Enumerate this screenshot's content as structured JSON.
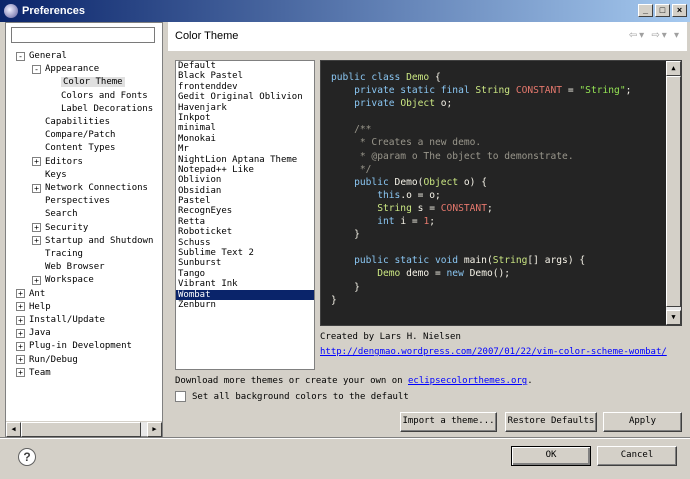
{
  "window": {
    "title": "Preferences"
  },
  "filter": {
    "placeholder": "",
    "value": ""
  },
  "tree": [
    {
      "label": "General",
      "depth": 0,
      "exp": "-"
    },
    {
      "label": "Appearance",
      "depth": 1,
      "exp": "-"
    },
    {
      "label": "Color Theme",
      "depth": 2,
      "exp": "",
      "selected": true
    },
    {
      "label": "Colors and Fonts",
      "depth": 2,
      "exp": ""
    },
    {
      "label": "Label Decorations",
      "depth": 2,
      "exp": ""
    },
    {
      "label": "Capabilities",
      "depth": 1,
      "exp": ""
    },
    {
      "label": "Compare/Patch",
      "depth": 1,
      "exp": ""
    },
    {
      "label": "Content Types",
      "depth": 1,
      "exp": ""
    },
    {
      "label": "Editors",
      "depth": 1,
      "exp": "+"
    },
    {
      "label": "Keys",
      "depth": 1,
      "exp": ""
    },
    {
      "label": "Network Connections",
      "depth": 1,
      "exp": "+"
    },
    {
      "label": "Perspectives",
      "depth": 1,
      "exp": ""
    },
    {
      "label": "Search",
      "depth": 1,
      "exp": ""
    },
    {
      "label": "Security",
      "depth": 1,
      "exp": "+"
    },
    {
      "label": "Startup and Shutdown",
      "depth": 1,
      "exp": "+"
    },
    {
      "label": "Tracing",
      "depth": 1,
      "exp": ""
    },
    {
      "label": "Web Browser",
      "depth": 1,
      "exp": ""
    },
    {
      "label": "Workspace",
      "depth": 1,
      "exp": "+"
    },
    {
      "label": "Ant",
      "depth": 0,
      "exp": "+"
    },
    {
      "label": "Help",
      "depth": 0,
      "exp": "+"
    },
    {
      "label": "Install/Update",
      "depth": 0,
      "exp": "+"
    },
    {
      "label": "Java",
      "depth": 0,
      "exp": "+"
    },
    {
      "label": "Plug-in Development",
      "depth": 0,
      "exp": "+"
    },
    {
      "label": "Run/Debug",
      "depth": 0,
      "exp": "+"
    },
    {
      "label": "Team",
      "depth": 0,
      "exp": "+"
    }
  ],
  "page": {
    "title": "Color Theme"
  },
  "themes": [
    "Default",
    "Black Pastel",
    "frontenddev",
    "Gedit Original Oblivion",
    "Havenjark",
    "Inkpot",
    "minimal",
    "Monokai",
    "Mr",
    "NightLion Aptana Theme",
    "Notepad++ Like",
    "Oblivion",
    "Obsidian",
    "Pastel",
    "RecognEyes",
    "Retta",
    "Roboticket",
    "Schuss",
    "Sublime Text 2",
    "Sunburst",
    "Tango",
    "Vibrant Ink",
    "Wombat",
    "Zenburn"
  ],
  "selected_theme": "Wombat",
  "code_lines": [
    [
      [
        "public class ",
        "kw"
      ],
      [
        "Demo",
        "type"
      ],
      [
        " {",
        "plain"
      ]
    ],
    [
      [
        "    private static final ",
        "kw"
      ],
      [
        "String",
        "type"
      ],
      [
        " ",
        "plain"
      ],
      [
        "CONSTANT",
        "const"
      ],
      [
        " = ",
        "plain"
      ],
      [
        "\"String\"",
        "str"
      ],
      [
        ";",
        "plain"
      ]
    ],
    [
      [
        "    private ",
        "kw"
      ],
      [
        "Object",
        "type"
      ],
      [
        " o;",
        "plain"
      ]
    ],
    [
      [
        "",
        "plain"
      ]
    ],
    [
      [
        "    /**",
        "comment"
      ]
    ],
    [
      [
        "     * Creates a new demo.",
        "comment"
      ]
    ],
    [
      [
        "     * @param o The object to demonstrate.",
        "comment"
      ]
    ],
    [
      [
        "     */",
        "comment"
      ]
    ],
    [
      [
        "    public ",
        "kw"
      ],
      [
        "Demo",
        "plain"
      ],
      [
        "(",
        "plain"
      ],
      [
        "Object",
        "type"
      ],
      [
        " o) {",
        "plain"
      ]
    ],
    [
      [
        "        this",
        "kw"
      ],
      [
        ".o = o;",
        "plain"
      ]
    ],
    [
      [
        "        String",
        "type"
      ],
      [
        " s = ",
        "plain"
      ],
      [
        "CONSTANT",
        "const"
      ],
      [
        ";",
        "plain"
      ]
    ],
    [
      [
        "        int",
        "kw"
      ],
      [
        " i = ",
        "plain"
      ],
      [
        "1",
        "num"
      ],
      [
        ";",
        "plain"
      ]
    ],
    [
      [
        "    }",
        "plain"
      ]
    ],
    [
      [
        "",
        "plain"
      ]
    ],
    [
      [
        "    public static void ",
        "kw"
      ],
      [
        "main",
        "plain"
      ],
      [
        "(",
        "plain"
      ],
      [
        "String",
        "type"
      ],
      [
        "[] args) {",
        "plain"
      ]
    ],
    [
      [
        "        Demo",
        "type"
      ],
      [
        " demo = ",
        "plain"
      ],
      [
        "new ",
        "kw"
      ],
      [
        "Demo",
        "plain"
      ],
      [
        "();",
        "plain"
      ]
    ],
    [
      [
        "    }",
        "plain"
      ]
    ],
    [
      [
        "}",
        "plain"
      ]
    ]
  ],
  "code_colors": {
    "kw": "#8ac6f2",
    "type": "#cae682",
    "const": "#e5786d",
    "str": "#95e454",
    "comment": "#99968b",
    "num": "#e5786d",
    "plain": "#f6f3e8"
  },
  "credit": "Created by Lars H. Nielsen",
  "credit_link": "http://dengmao.wordpress.com/2007/01/22/vim-color-scheme-wombat/",
  "download": {
    "prefix": "Download more themes or create your own on ",
    "link": "eclipsecolorthemes.org",
    "suffix": "."
  },
  "checkbox": {
    "label": "Set all background colors to the default",
    "checked": false
  },
  "buttons": {
    "import": "Import a theme...",
    "restore": "Restore Defaults",
    "apply": "Apply",
    "ok": "OK",
    "cancel": "Cancel"
  },
  "icons": {
    "help": "?",
    "back": "⇦",
    "forward": "⇨",
    "menu": "▾"
  }
}
